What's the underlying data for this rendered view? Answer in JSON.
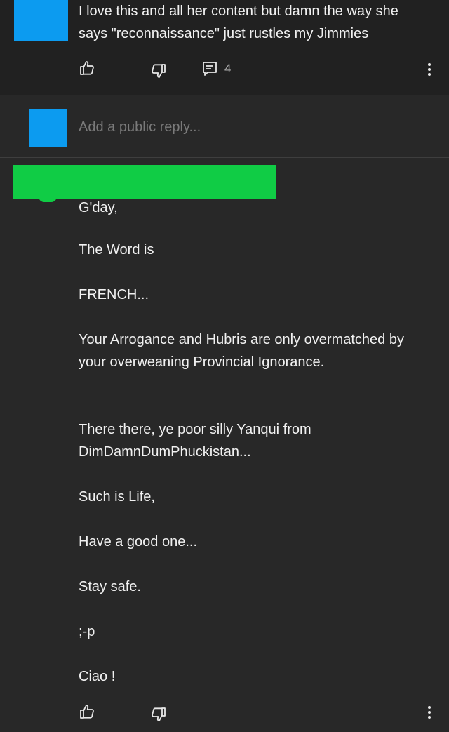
{
  "top_comment": {
    "text": "I love this and all her content but damn the way she\nsays \"reconnaissance\" just rustles my Jimmies",
    "reply_count": "4",
    "avatar_color": "#0c9bf0"
  },
  "reply_box": {
    "placeholder": "Add a public reply...",
    "avatar_color": "#0c9bf0"
  },
  "reply": {
    "redaction_color": "#10cc45",
    "paragraphs": [
      "G'day,",
      "The Word is",
      "FRENCH...",
      "Your Arrogance and Hubris are only overmatched by your overweaning Provincial Ignorance.",
      "There there, ye poor silly Yanqui from DimDamnDumPhuckistan...",
      "Such is Life,",
      "Have a good one...",
      "Stay safe.",
      ";-p",
      "Ciao !"
    ]
  },
  "icons": {
    "like": "thumbs-up-icon",
    "dislike": "thumbs-down-icon",
    "reply": "reply-comment-icon",
    "more": "more-vert-icon"
  }
}
